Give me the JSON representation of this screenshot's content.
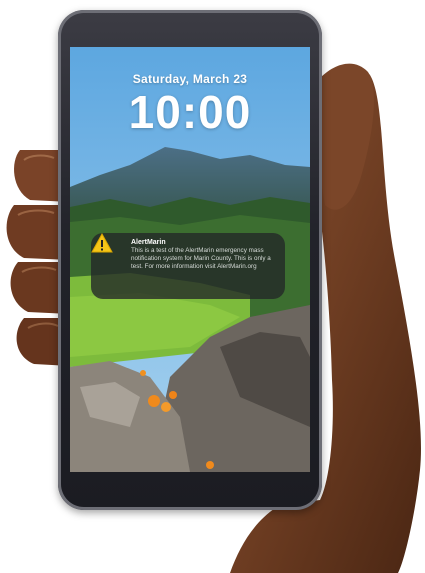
{
  "lock_screen": {
    "date": "Saturday, March 23",
    "time": "10:00"
  },
  "notification": {
    "app_name": "AlertMarin",
    "message": "This is a test of the AlertMarin emergency mass notification system for Marin County. This is only a test. For more information visit AlertMarin.org",
    "icon": "warning-triangle-icon"
  },
  "colors": {
    "warning_yellow": "#f5c518",
    "sky": "#6fb0df",
    "hill_green": "#7dbb3c",
    "poppy_orange": "#f08a1c"
  }
}
